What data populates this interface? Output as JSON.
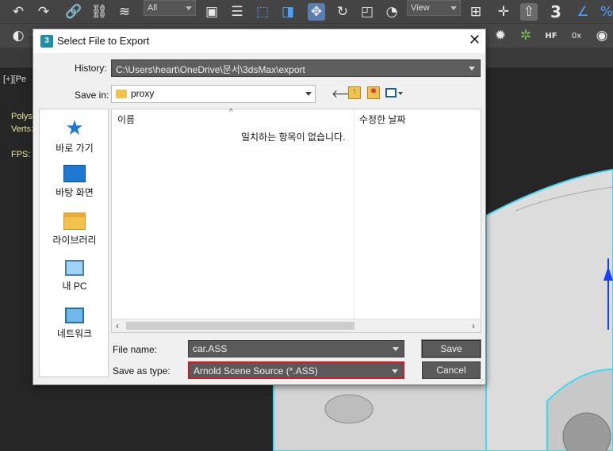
{
  "toolbar": {
    "selection_filter": "All",
    "reference_coord": "View",
    "snap_label": "3"
  },
  "toolbar2": {
    "hf_label": "HF",
    "ox_label": "0x"
  },
  "viewport": {
    "label": "[+][Pe",
    "polys_label": "Polys",
    "verts_label": "Verts:",
    "fps_label": "FPS:"
  },
  "dialog": {
    "title": "Select File to Export",
    "history_label": "History:",
    "history_value": "C:\\Users\\heart\\OneDrive\\문서\\3dsMax\\export",
    "save_in_label": "Save in:",
    "save_in_value": "proxy",
    "places": [
      {
        "label": "바로 가기"
      },
      {
        "label": "바탕 화면"
      },
      {
        "label": "라이브러리"
      },
      {
        "label": "내 PC"
      },
      {
        "label": "네트워크"
      }
    ],
    "columns": {
      "name": "이름",
      "modified": "수정한 날짜"
    },
    "empty_message": "일치하는 항목이 없습니다.",
    "file_name_label": "File name:",
    "file_name_value": "car.ASS",
    "save_as_type_label": "Save as type:",
    "save_as_type_value": "Arnold Scene Source (*.ASS)",
    "save_button": "Save",
    "cancel_button": "Cancel"
  },
  "colors": {
    "highlight": "#e0141e",
    "accent": "#1e78d2",
    "outline": "#40d8f0"
  }
}
